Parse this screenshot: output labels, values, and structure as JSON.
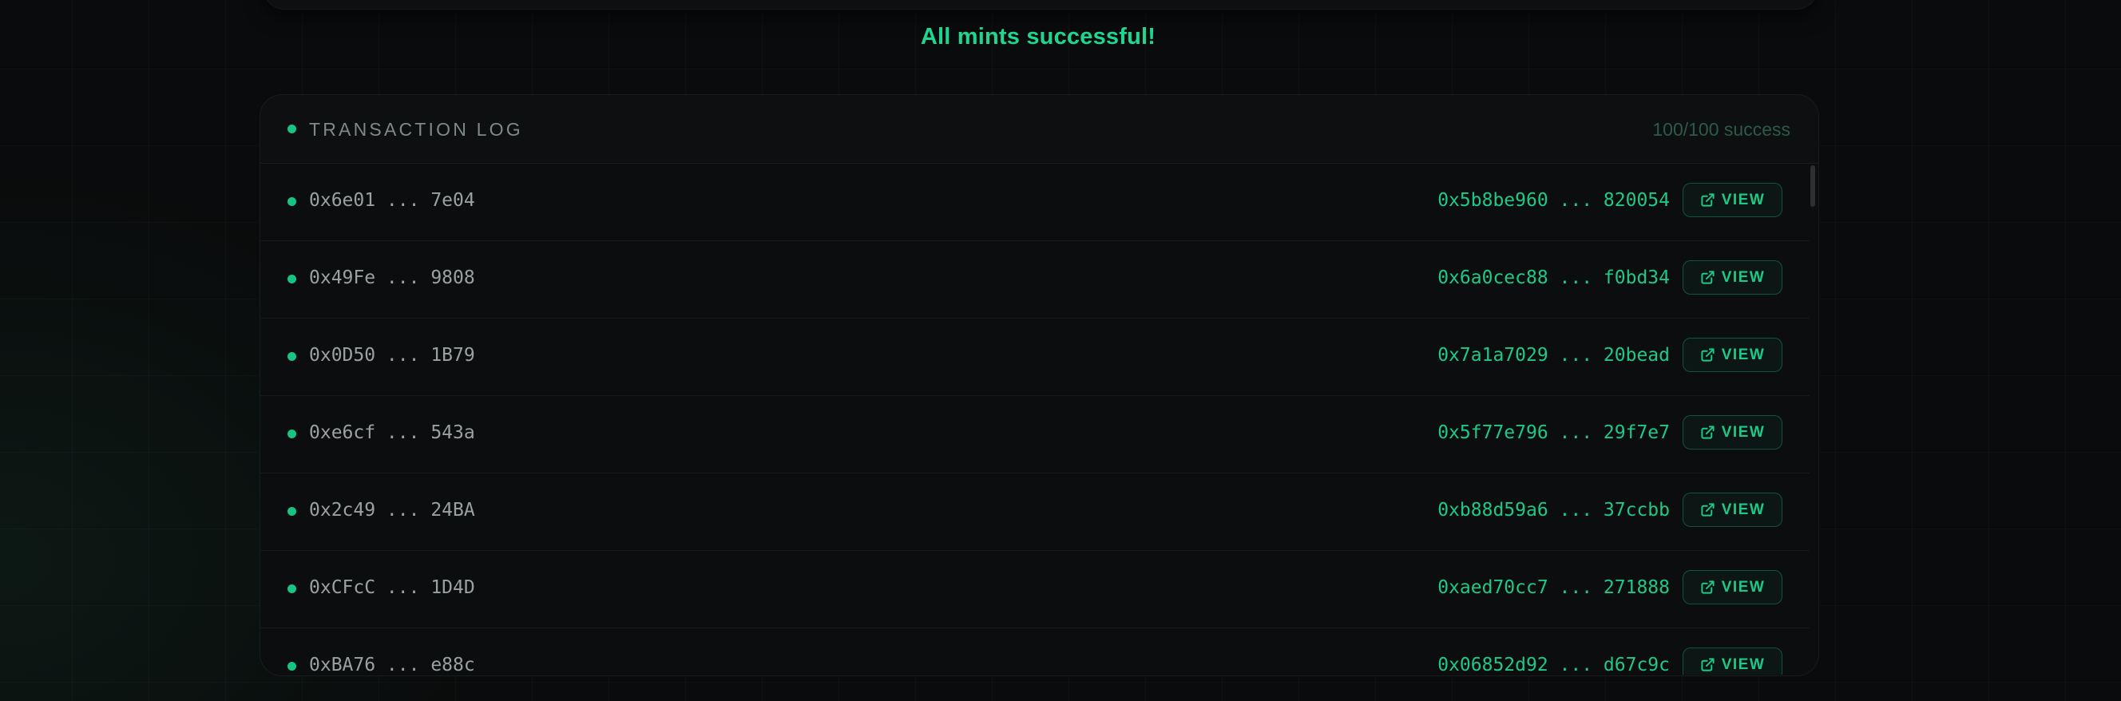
{
  "status_message": "All mints successful!",
  "log": {
    "title": "TRANSACTION LOG",
    "count": "100/100 success",
    "view_label": "VIEW",
    "rows": [
      {
        "address": "0x6e01 ... 7e04",
        "hash": "0x5b8be960 ... 820054"
      },
      {
        "address": "0x49Fe ... 9808",
        "hash": "0x6a0cec88 ... f0bd34"
      },
      {
        "address": "0x0D50 ... 1B79",
        "hash": "0x7a1a7029 ... 20bead"
      },
      {
        "address": "0xe6cf ... 543a",
        "hash": "0x5f77e796 ... 29f7e7"
      },
      {
        "address": "0x2c49 ... 24BA",
        "hash": "0xb88d59a6 ... 37ccbb"
      },
      {
        "address": "0xCFcC ... 1D4D",
        "hash": "0xaed70cc7 ... 271888"
      },
      {
        "address": "0xBA76 ... e88c",
        "hash": "0x06852d92 ... d67c9c"
      }
    ]
  },
  "colors": {
    "accent": "#1ec987",
    "background": "#0a0b0c"
  },
  "icons": {
    "status": "dot-icon",
    "view": "external-link-icon"
  }
}
